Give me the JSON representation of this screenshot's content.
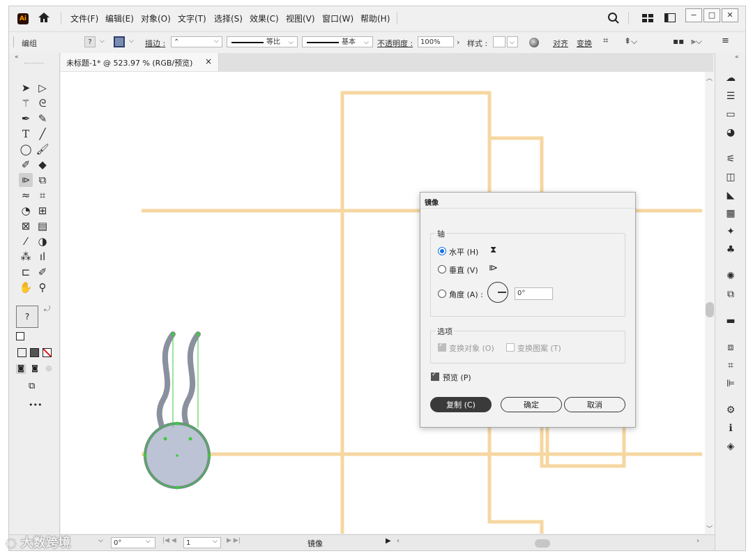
{
  "app": {
    "logo": "Ai"
  },
  "menubar": {
    "items": [
      "文件(F)",
      "编辑(E)",
      "对象(O)",
      "文字(T)",
      "选择(S)",
      "效果(C)",
      "视图(V)",
      "窗口(W)",
      "帮助(H)"
    ]
  },
  "window_controls": {
    "minimize": "−",
    "restore": "□",
    "close": "✕"
  },
  "control_bar": {
    "selection_label": "编组",
    "fill_value": "?",
    "stroke_label": "描边 :",
    "stroke_profile": "等比",
    "brush_label": "基本",
    "opacity_label": "不透明度 :",
    "opacity_value": "100%",
    "style_label": "样式 :",
    "align_label": "对齐",
    "transform_label": "变换"
  },
  "document_tab": {
    "title": "未标题-1* @ 523.97 % (RGB/预览)",
    "close": "×"
  },
  "toolbar": {
    "fill_stroke_label": "?",
    "more": "•••"
  },
  "status_bar": {
    "rotation_value": "0°",
    "artboard_value": "1",
    "tool_name": "镜像"
  },
  "dialog": {
    "title": "镜像",
    "axis_group": "轴",
    "horizontal_label": "水平 (H)",
    "vertical_label": "垂直 (V)",
    "angle_label": "角度 (A) :",
    "angle_value": "0°",
    "options_group": "选项",
    "transform_objects_label": "变换对象 (O)",
    "transform_patterns_label": "变换图案 (T)",
    "preview_label": "预览 (P)",
    "copy_button": "复制 (C)",
    "ok_button": "确定",
    "cancel_button": "取消",
    "selected_axis": "horizontal",
    "preview_checked": true
  },
  "watermark": {
    "text": "大数跨境"
  },
  "colors": {
    "guide_lines": "#f6d7a0",
    "shape_fill": "#bcc3d4",
    "shape_stroke": "#6f8a86",
    "squiggle": "#8a909e",
    "selection": "#3ec93e",
    "accent": "#1473e6"
  }
}
